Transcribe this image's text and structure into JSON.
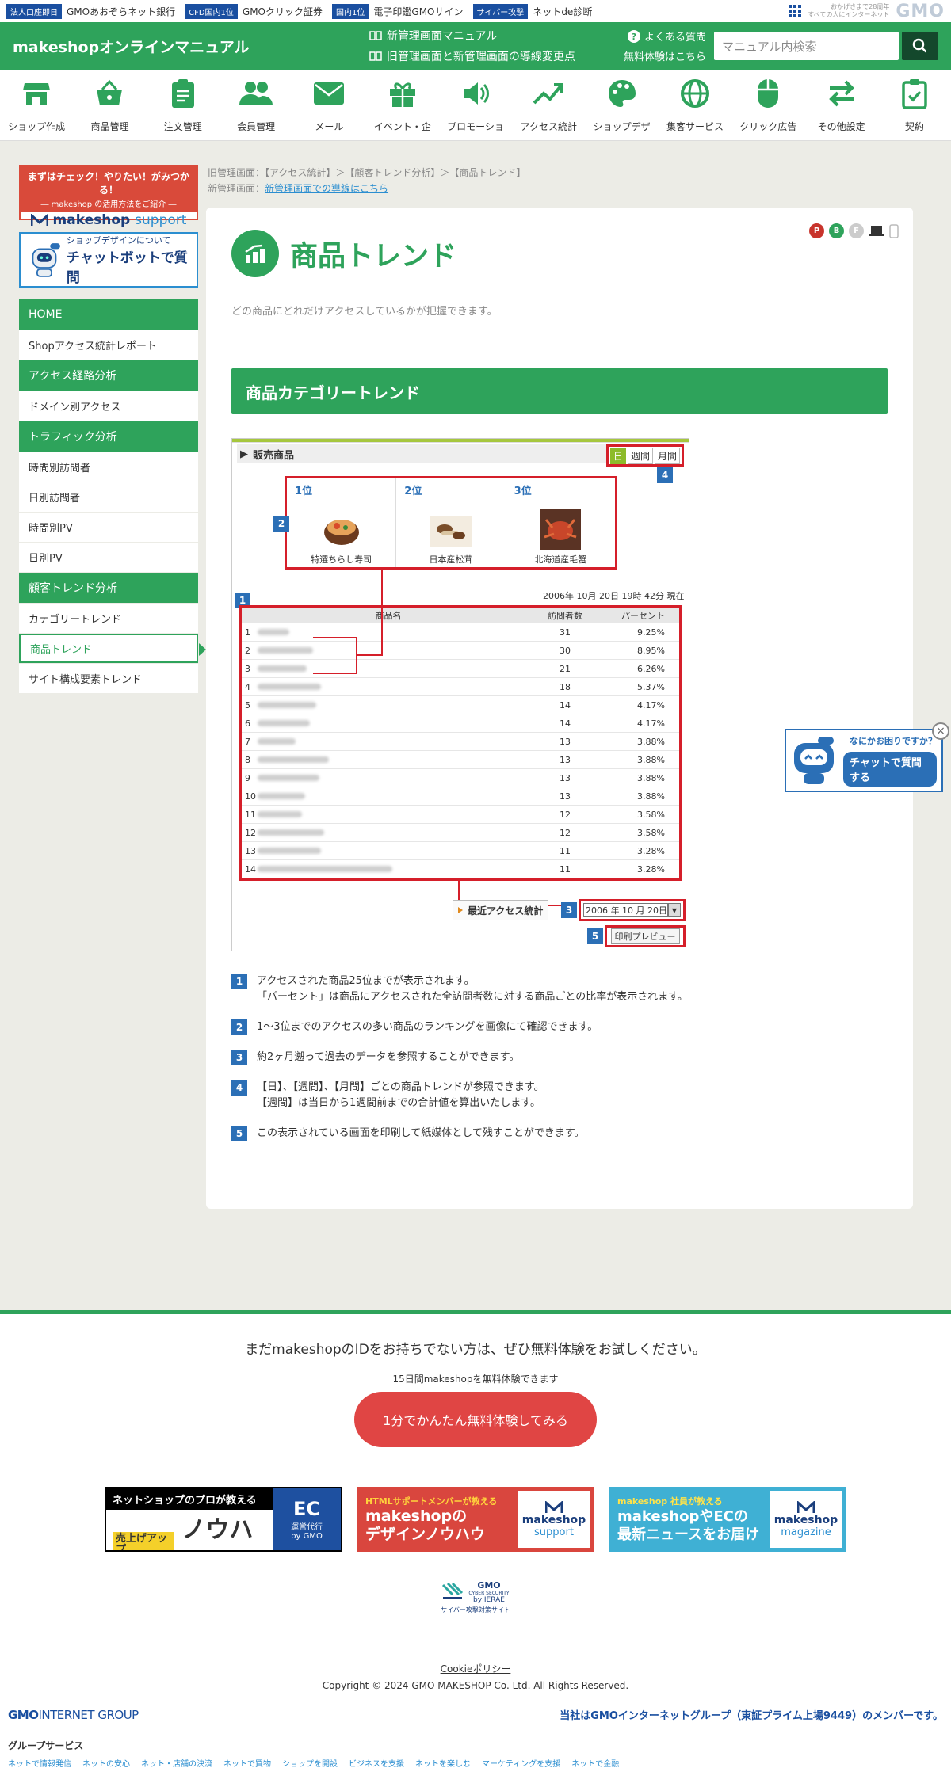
{
  "gmobar": {
    "items": [
      {
        "tag": "法人口座即日",
        "text": "GMOあおぞらネット銀行"
      },
      {
        "tag": "CFD国内1位",
        "text": "GMOクリック証券"
      },
      {
        "tag": "国内1位",
        "text": "電子印鑑GMOサイン"
      },
      {
        "tag": "サイバー攻撃",
        "text": "ネットde診断"
      }
    ],
    "tagline1": "おかげさまで28周年",
    "tagline2": "すべての人にインターネット",
    "logo": "GMO"
  },
  "header": {
    "title": "makeshopオンラインマニュアル",
    "link1": "新管理画面マニュアル",
    "link2": "旧管理画面と新管理画面の導線変更点",
    "faq": "よくある質問",
    "trial": "無料体験はこちら",
    "search_placeholder": "マニュアル内検索"
  },
  "nav": [
    "ショップ作成",
    "商品管理",
    "注文管理",
    "会員管理",
    "メール",
    "イベント・企",
    "プロモーショ",
    "アクセス統計",
    "ショップデザ",
    "集客サービス",
    "クリック広告",
    "その他設定",
    "契約"
  ],
  "sidebar": {
    "banner1_line1": "まずはチェック！やりたい！がみつかる！",
    "banner1_line2": "― makeshop の活用方法をご紹介 ―",
    "banner1_brand": "makeshop",
    "banner1_brand2": "support",
    "banner2_line1": "ショップデザインについて",
    "banner2_line2": "チャットボットで質問",
    "menu": [
      {
        "type": "head",
        "label": "HOME"
      },
      {
        "type": "item",
        "label": "Shopアクセス統計レポート"
      },
      {
        "type": "head",
        "label": "アクセス経路分析"
      },
      {
        "type": "item",
        "label": "ドメイン別アクセス"
      },
      {
        "type": "head",
        "label": "トラフィック分析"
      },
      {
        "type": "item",
        "label": "時間別訪問者"
      },
      {
        "type": "item",
        "label": "日別訪問者"
      },
      {
        "type": "item",
        "label": "時間別PV"
      },
      {
        "type": "item",
        "label": "日別PV"
      },
      {
        "type": "head",
        "label": "顧客トレンド分析"
      },
      {
        "type": "item",
        "label": "カテゴリートレンド"
      },
      {
        "type": "active",
        "label": "商品トレンド"
      },
      {
        "type": "item",
        "label": "サイト構成要素トレンド"
      }
    ]
  },
  "breadcrumb": {
    "old_label": "旧管理画面：",
    "old_path": "【アクセス統計】＞【顧客トレンド分析】＞【商品トレンド】",
    "new_label": "新管理画面：",
    "new_link": "新管理画面での導線はこちら"
  },
  "devices": [
    "P",
    "B",
    "F"
  ],
  "page": {
    "title": "商品トレンド",
    "description": "どの商品にどれだけアクセスしているかが把握できます。",
    "section": "商品カテゴリートレンド"
  },
  "shot": {
    "header": "販売商品",
    "tabs": [
      "日",
      "週間",
      "月間"
    ],
    "ranks": [
      {
        "label": "1位",
        "name": "特選ちらし寿司"
      },
      {
        "label": "2位",
        "name": "日本産松茸"
      },
      {
        "label": "3位",
        "name": "北海道産毛蟹"
      }
    ],
    "stamp": "2006年 10月 20日 19時 42分 現在",
    "columns": [
      "商品名",
      "訪問者数",
      "パーセント"
    ],
    "rows": [
      {
        "n": "1",
        "v": "31",
        "p": "9.25%"
      },
      {
        "n": "2",
        "v": "30",
        "p": "8.95%"
      },
      {
        "n": "3",
        "v": "21",
        "p": "6.26%"
      },
      {
        "n": "4",
        "v": "18",
        "p": "5.37%"
      },
      {
        "n": "5",
        "v": "14",
        "p": "4.17%"
      },
      {
        "n": "6",
        "v": "14",
        "p": "4.17%"
      },
      {
        "n": "7",
        "v": "13",
        "p": "3.88%"
      },
      {
        "n": "8",
        "v": "13",
        "p": "3.88%"
      },
      {
        "n": "9",
        "v": "13",
        "p": "3.88%"
      },
      {
        "n": "10",
        "v": "13",
        "p": "3.88%"
      },
      {
        "n": "11",
        "v": "12",
        "p": "3.58%"
      },
      {
        "n": "12",
        "v": "12",
        "p": "3.58%"
      },
      {
        "n": "13",
        "v": "11",
        "p": "3.28%"
      },
      {
        "n": "14",
        "v": "11",
        "p": "3.28%"
      }
    ],
    "recent": "最近アクセス統計",
    "date": "2006 年 10 月 20日",
    "print": "印刷プレビュー",
    "markers": [
      "1",
      "2",
      "3",
      "4",
      "5"
    ]
  },
  "notes": [
    {
      "n": "1",
      "lines": [
        "アクセスされた商品25位までが表示されます。",
        "「パーセント」は商品にアクセスされた全訪問者数に対する商品ごとの比率が表示されます。"
      ]
    },
    {
      "n": "2",
      "lines": [
        "1〜3位までのアクセスの多い商品のランキングを画像にて確認できます。"
      ]
    },
    {
      "n": "3",
      "lines": [
        "約2ヶ月遡って過去のデータを参照することができます。"
      ]
    },
    {
      "n": "4",
      "lines": [
        "【日】、【週間】、【月間】ごとの商品トレンドが参照できます。",
        "【週間】は当日から1週間前までの合計値を算出いたします。"
      ]
    },
    {
      "n": "5",
      "lines": [
        "この表示されている画面を印刷して紙媒体として残すことができます。"
      ]
    }
  ],
  "chatbot": {
    "line1": "なにかお困りですか？",
    "line2": "チャットで質問する"
  },
  "footer": {
    "cta_title": "まだmakeshopのIDをお持ちでない方は、ぜひ無料体験をお試しください。",
    "cta_sub": "15日間makeshopを無料体験できます",
    "cta_button": "1分でかんたん無料体験してみる",
    "fb1_top": "ネットショップのプロが教える",
    "fb1_tag": "売上げアップ",
    "fb1_big": "ノウハウ",
    "fb1_r1": "EC",
    "fb1_r2": "運営代行",
    "fb1_r3": "by GMO",
    "fb2_top": "HTMLサポートメンバーが教える",
    "fb2_l1": "makeshopの",
    "fb2_l2": "デザインノウハウ",
    "fb2_r1": "makeshop",
    "fb2_r2": "support",
    "fb3_top": "makeshop 社員が教える",
    "fb3_l1": "makeshopやECの",
    "fb3_l2": "最新ニュースをお届け",
    "fb3_r1": "makeshop",
    "fb3_r2": "magazine",
    "sec1": "GMO",
    "sec2": "CYBER SECURITY",
    "sec3": "by IERAE",
    "sec4": "サイバー攻撃対策サイト",
    "cookie": "Cookieポリシー",
    "copyright": "Copyright © 2024 GMO MAKESHOP Co. Ltd. All Rights Reserved.",
    "group_logo1": "GMO",
    "group_logo2": "INTERNET GROUP",
    "member": "当社はGMOインターネットグループ（東証プライム上場9449）のメンバーです。",
    "group_services": "グループサービス",
    "service_links": [
      "ネットで情報発信",
      "ネットの安心",
      "ネット・店舗の決済",
      "ネットで買物",
      "ショップを開設",
      "ビジネスを支援",
      "ネットを楽しむ",
      "マーケティングを支援",
      "ネットで金融"
    ]
  },
  "colors": {
    "brand_green": "#2ea35b",
    "marker_blue": "#2b6fb6",
    "highlight_red": "#d51f2a",
    "cta_red": "#e04544"
  }
}
